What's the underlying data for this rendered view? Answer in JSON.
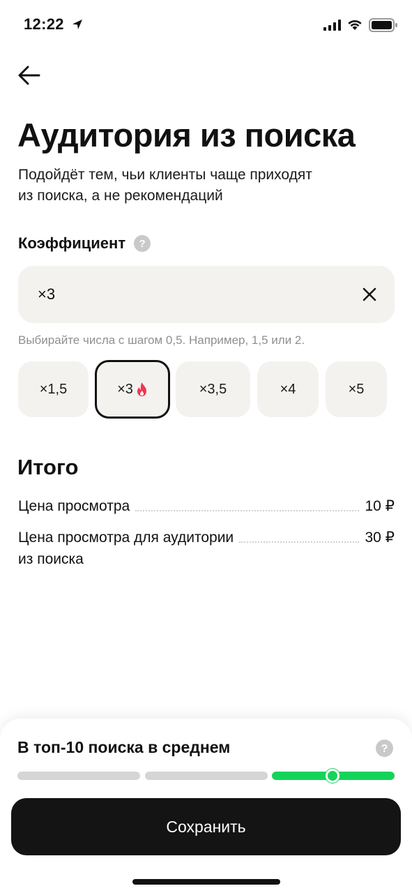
{
  "status_bar": {
    "time": "12:22"
  },
  "header": {
    "title": "Аудитория из поиска",
    "subtitle_line1": "Подойдёт тем, чьи клиенты чаще приходят",
    "subtitle_line2": "из поиска, а не рекомендаций"
  },
  "coefficient": {
    "label": "Коэффициент",
    "help_glyph": "?",
    "value": "×3",
    "hint": "Выбирайте числа с шагом 0,5. Например, 1,5 или 2.",
    "options": [
      {
        "label": "×1,5",
        "selected": false
      },
      {
        "label": "×3",
        "selected": true,
        "icon": "fire-icon"
      },
      {
        "label": "×3,5",
        "selected": false
      },
      {
        "label": "×4",
        "selected": false
      },
      {
        "label": "×5",
        "selected": false
      }
    ]
  },
  "summary": {
    "title": "Итого",
    "rows": [
      {
        "label": "Цена просмотра",
        "value": "10 ₽"
      },
      {
        "label": "Цена просмотра для аудитории",
        "label_line2": "из поиска",
        "value": "30 ₽"
      }
    ]
  },
  "bottom_sheet": {
    "title": "В топ-10 поиска в среднем",
    "progress": {
      "segments": 3,
      "active_segment": 3,
      "knob_position_in_segment": 0.5
    },
    "accent_color": "#15d35a",
    "save_label": "Сохранить"
  }
}
